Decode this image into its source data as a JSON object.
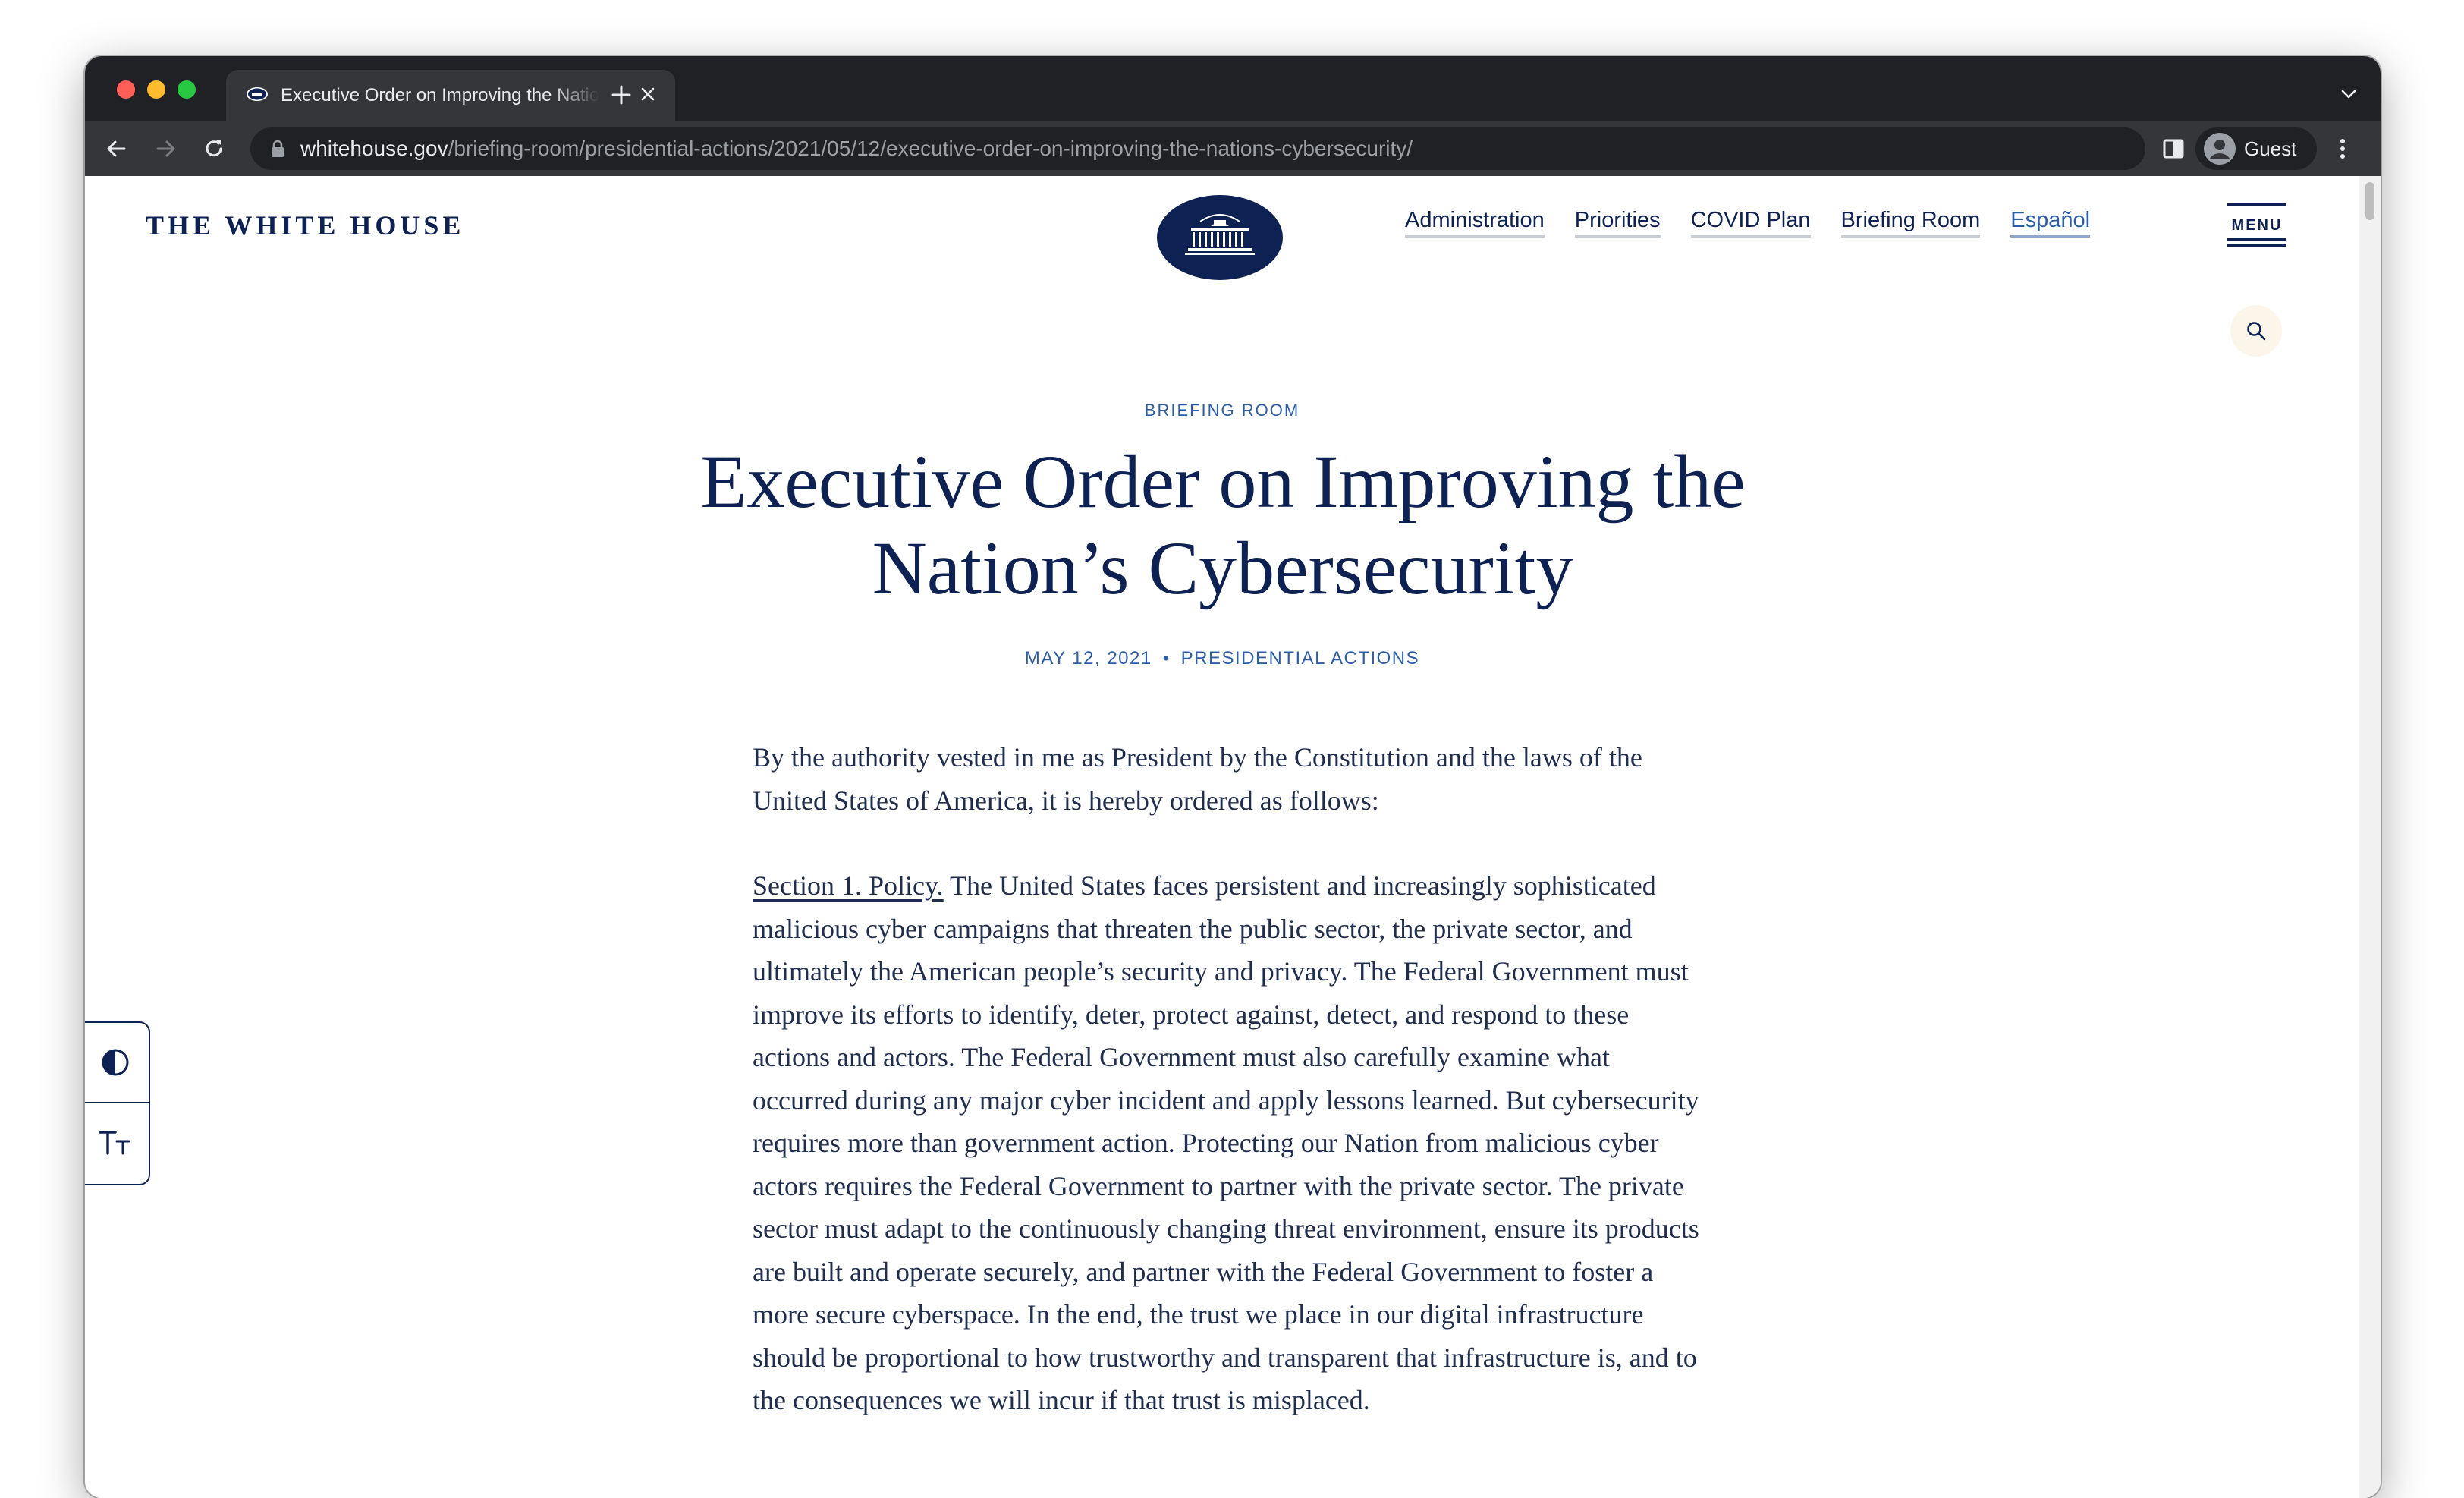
{
  "browser": {
    "tab": {
      "title": "Executive Order on Improving the Nation's Cybersecurity"
    },
    "address": {
      "host": "whitehouse.gov",
      "path": "/briefing-room/presidential-actions/2021/05/12/executive-order-on-improving-the-nations-cybersecurity/"
    },
    "profile_label": "Guest"
  },
  "site": {
    "wordmark": "THE WHITE HOUSE",
    "nav": {
      "administration": "Administration",
      "priorities": "Priorities",
      "covid": "COVID Plan",
      "briefing": "Briefing Room",
      "espanol": "Español"
    },
    "menu_label": "MENU"
  },
  "article": {
    "eyebrow": "BRIEFING ROOM",
    "title": "Executive Order on Improving the Nation’s Cybersecurity",
    "date": "MAY 12, 2021",
    "separator": "•",
    "category": "PRESIDENTIAL ACTIONS",
    "intro": "By the authority vested in me as President by the Constitution and the laws of the United States of America, it is hereby ordered as follows:",
    "section_heading": "Section 1.  Policy.",
    "section_text": "  The United States faces persistent and increasingly sophisticated malicious cyber campaigns that threaten the public sector, the private sector, and ultimately the American people’s security and privacy.  The Federal Government must improve its efforts to identify, deter, protect against, detect, and respond to these actions and actors.  The Federal Government must also carefully examine what occurred during any major cyber incident and apply lessons learned.  But cybersecurity requires more than government action.  Protecting our Nation from malicious cyber actors requires the Federal Government to partner with the private sector.  The private sector must adapt to the continuously changing threat environment, ensure its products are built and operate securely, and partner with the Federal Government to foster a more secure cyberspace.  In the end, the trust we place in our digital infrastructure should be proportional to how trustworthy and transparent that infrastructure is, and to the consequences we will incur if that trust is misplaced."
  },
  "colors": {
    "navy": "#0d2253",
    "accent_blue": "#2c5ea8",
    "chrome_dark": "#202124",
    "chrome_toolbar": "#35363a"
  }
}
